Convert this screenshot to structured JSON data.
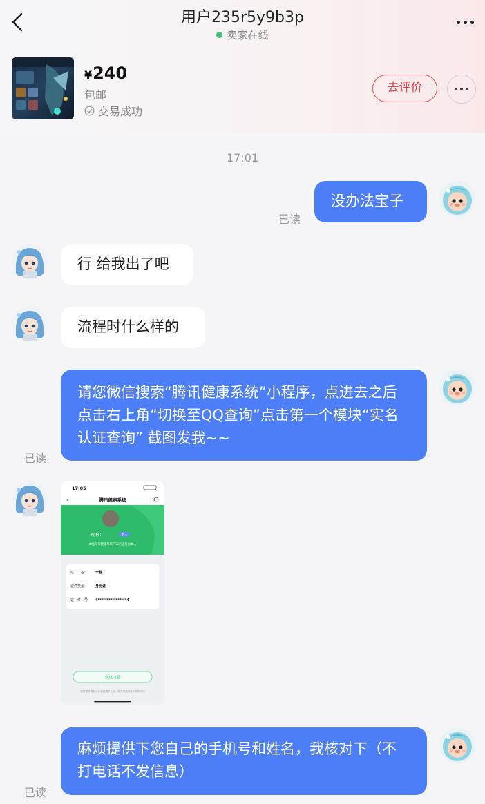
{
  "header": {
    "title": "用户235r5y9b3p",
    "status": "卖家在线"
  },
  "product": {
    "currency": "¥",
    "price": "240",
    "shipping": "包邮",
    "deal_status": "交易成功",
    "review_label": "去评价"
  },
  "chat": {
    "timestamp": "17:01",
    "read_label": "已读",
    "messages": [
      {
        "sender": "me",
        "text": "没办法宝子"
      },
      {
        "sender": "them",
        "text": "行 给我出了吧"
      },
      {
        "sender": "them",
        "text": "流程时什么样的"
      },
      {
        "sender": "me",
        "text": "请您微信搜索“腾讯健康系统”小程序，点进去之后点击右上角“切换至QQ查询”点击第一个模块“实名认证查询” 截图发我~~"
      },
      {
        "sender": "them",
        "type": "image"
      },
      {
        "sender": "me",
        "text": "麻烦提供下您自己的手机号和姓名，我核对下（不打电话不发信息）"
      }
    ]
  },
  "screenshot": {
    "time": "17:05",
    "app_title": "腾讯健康系统",
    "nickname_label": "昵称：",
    "tag": "本人",
    "notice": "本账号仅健康系统内实名信息为本人",
    "rows": [
      {
        "label": "姓　　名:",
        "value": "**胜"
      },
      {
        "label": "证件类型:",
        "value": "身份证"
      },
      {
        "label": "证　件　号:",
        "value": "4****************4"
      }
    ],
    "button": "常见问题",
    "footer": "如需更改请到公安系统重新认证，首次请使用本人手机号码"
  },
  "colors": {
    "accent_blue": "#4c7ef7",
    "review_red": "#e8434b",
    "online_green": "#3dc47e"
  }
}
